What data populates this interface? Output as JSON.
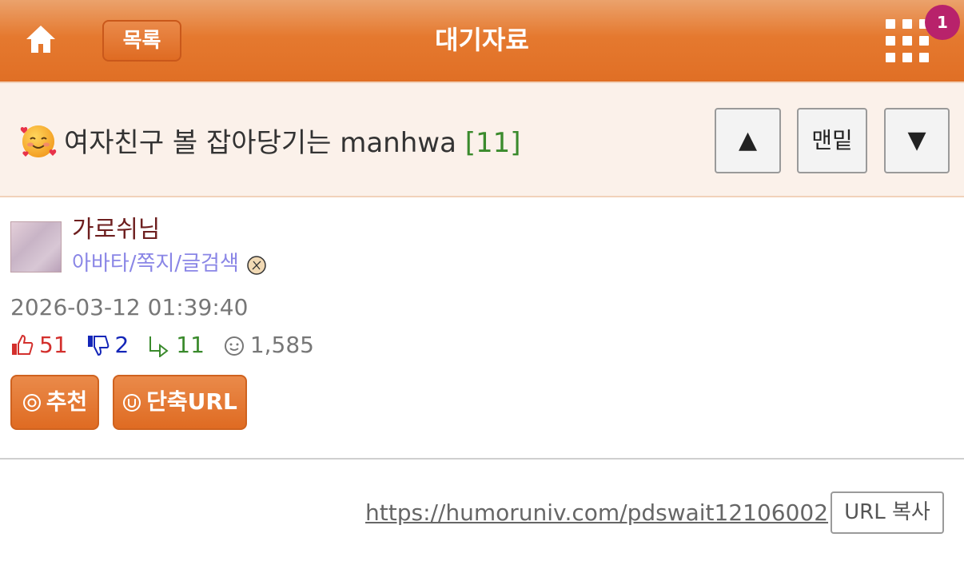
{
  "header": {
    "home_icon": "home-icon",
    "list_label": "목록",
    "title": "대기자료",
    "menu_icon": "grid-menu-icon",
    "badge_count": "1",
    "colors": {
      "header": "#e5792f",
      "badge": "#b8226b"
    }
  },
  "post": {
    "emoji": "smiling-face-with-hearts-icon",
    "title": "여자친구 볼 잡아당기는 manhwa",
    "comment_count": "[11]",
    "nav": {
      "up": "▲",
      "bottom": "맨밑",
      "down": "▼"
    }
  },
  "author": {
    "name": "가로쉬님",
    "links": "아바타/쪽지/글검색",
    "date": "2026-03-12 01:39:40"
  },
  "stats": {
    "likes": "51",
    "dislikes": "2",
    "replies": "11",
    "views": "1,585"
  },
  "actions": {
    "recommend": "추천",
    "short_url": "단축URL"
  },
  "footer": {
    "url": "https://humoruniv.com/pdswait12106002",
    "copy": "URL 복사"
  }
}
